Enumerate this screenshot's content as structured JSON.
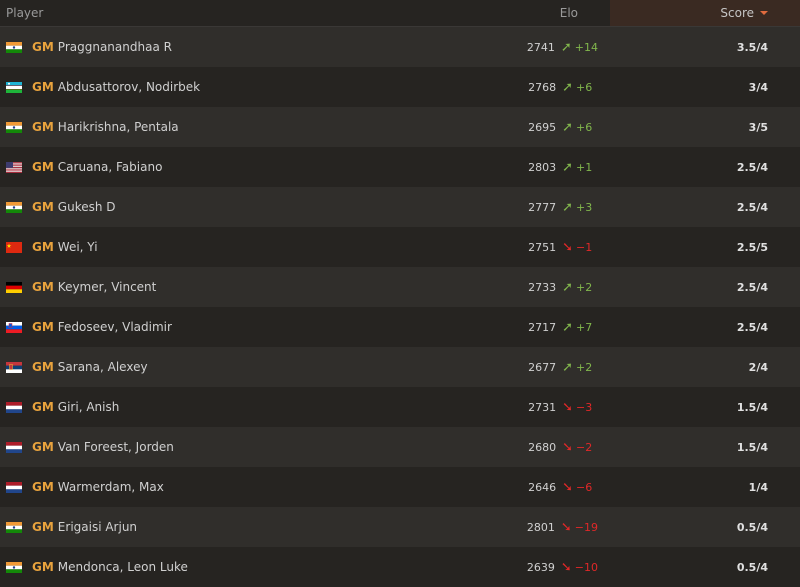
{
  "header": {
    "player": "Player",
    "elo": "Elo",
    "score": "Score"
  },
  "colors": {
    "up": "#81b64c",
    "down": "#e02828",
    "title": "#e9a33d"
  },
  "rows": [
    {
      "flag": "india",
      "title": "GM",
      "name": "Praggnanandhaa R",
      "elo": "2741",
      "dir": "up",
      "delta": "+14",
      "score": "3.5/4"
    },
    {
      "flag": "uzbekistan",
      "title": "GM",
      "name": "Abdusattorov, Nodirbek",
      "elo": "2768",
      "dir": "up",
      "delta": "+6",
      "score": "3/4"
    },
    {
      "flag": "india",
      "title": "GM",
      "name": "Harikrishna, Pentala",
      "elo": "2695",
      "dir": "up",
      "delta": "+6",
      "score": "3/5"
    },
    {
      "flag": "usa",
      "title": "GM",
      "name": "Caruana, Fabiano",
      "elo": "2803",
      "dir": "up",
      "delta": "+1",
      "score": "2.5/4"
    },
    {
      "flag": "india",
      "title": "GM",
      "name": "Gukesh D",
      "elo": "2777",
      "dir": "up",
      "delta": "+3",
      "score": "2.5/4"
    },
    {
      "flag": "china",
      "title": "GM",
      "name": "Wei, Yi",
      "elo": "2751",
      "dir": "down",
      "delta": "−1",
      "score": "2.5/5"
    },
    {
      "flag": "germany",
      "title": "GM",
      "name": "Keymer, Vincent",
      "elo": "2733",
      "dir": "up",
      "delta": "+2",
      "score": "2.5/4"
    },
    {
      "flag": "slovenia",
      "title": "GM",
      "name": "Fedoseev, Vladimir",
      "elo": "2717",
      "dir": "up",
      "delta": "+7",
      "score": "2.5/4"
    },
    {
      "flag": "serbia",
      "title": "GM",
      "name": "Sarana, Alexey",
      "elo": "2677",
      "dir": "up",
      "delta": "+2",
      "score": "2/4"
    },
    {
      "flag": "netherlands",
      "title": "GM",
      "name": "Giri, Anish",
      "elo": "2731",
      "dir": "down",
      "delta": "−3",
      "score": "1.5/4"
    },
    {
      "flag": "netherlands",
      "title": "GM",
      "name": "Van Foreest, Jorden",
      "elo": "2680",
      "dir": "down",
      "delta": "−2",
      "score": "1.5/4"
    },
    {
      "flag": "netherlands",
      "title": "GM",
      "name": "Warmerdam, Max",
      "elo": "2646",
      "dir": "down",
      "delta": "−6",
      "score": "1/4"
    },
    {
      "flag": "india",
      "title": "GM",
      "name": "Erigaisi Arjun",
      "elo": "2801",
      "dir": "down",
      "delta": "−19",
      "score": "0.5/4"
    },
    {
      "flag": "india",
      "title": "GM",
      "name": "Mendonca, Leon Luke",
      "elo": "2639",
      "dir": "down",
      "delta": "−10",
      "score": "0.5/4"
    }
  ]
}
